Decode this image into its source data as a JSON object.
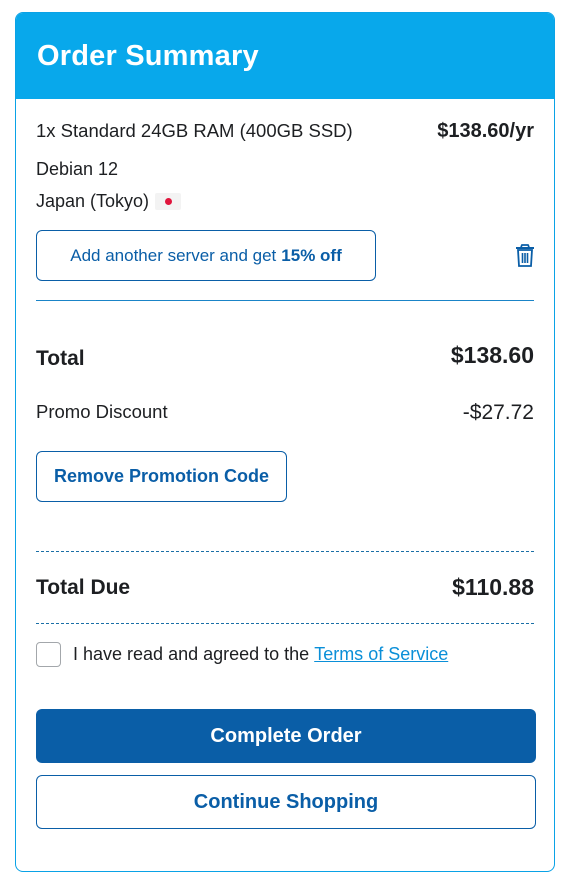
{
  "header": {
    "title": "Order Summary"
  },
  "item": {
    "name": "1x Standard 24GB RAM (400GB SSD)",
    "price": "$138.60/yr",
    "os": "Debian 12",
    "location": "Japan (Tokyo)",
    "flag_icon": "japan-flag-icon",
    "upsell_prefix": "Add another server and get",
    "upsell_highlight": "15% off",
    "delete_icon": "trash-icon"
  },
  "totals": {
    "total_label": "Total",
    "total_value": "$138.60",
    "promo_label": "Promo Discount",
    "promo_value": "-$27.72",
    "remove_promo_label": "Remove Promotion Code",
    "due_label": "Total Due",
    "due_value": "$110.88"
  },
  "tos": {
    "checked": false,
    "text": "I have read and agreed to the",
    "link_label": "Terms of Service"
  },
  "actions": {
    "complete_label": "Complete Order",
    "continue_label": "Continue Shopping"
  },
  "colors": {
    "header_bg": "#08a8eb",
    "primary": "#0a5ea7",
    "link": "#0a8fd8"
  }
}
